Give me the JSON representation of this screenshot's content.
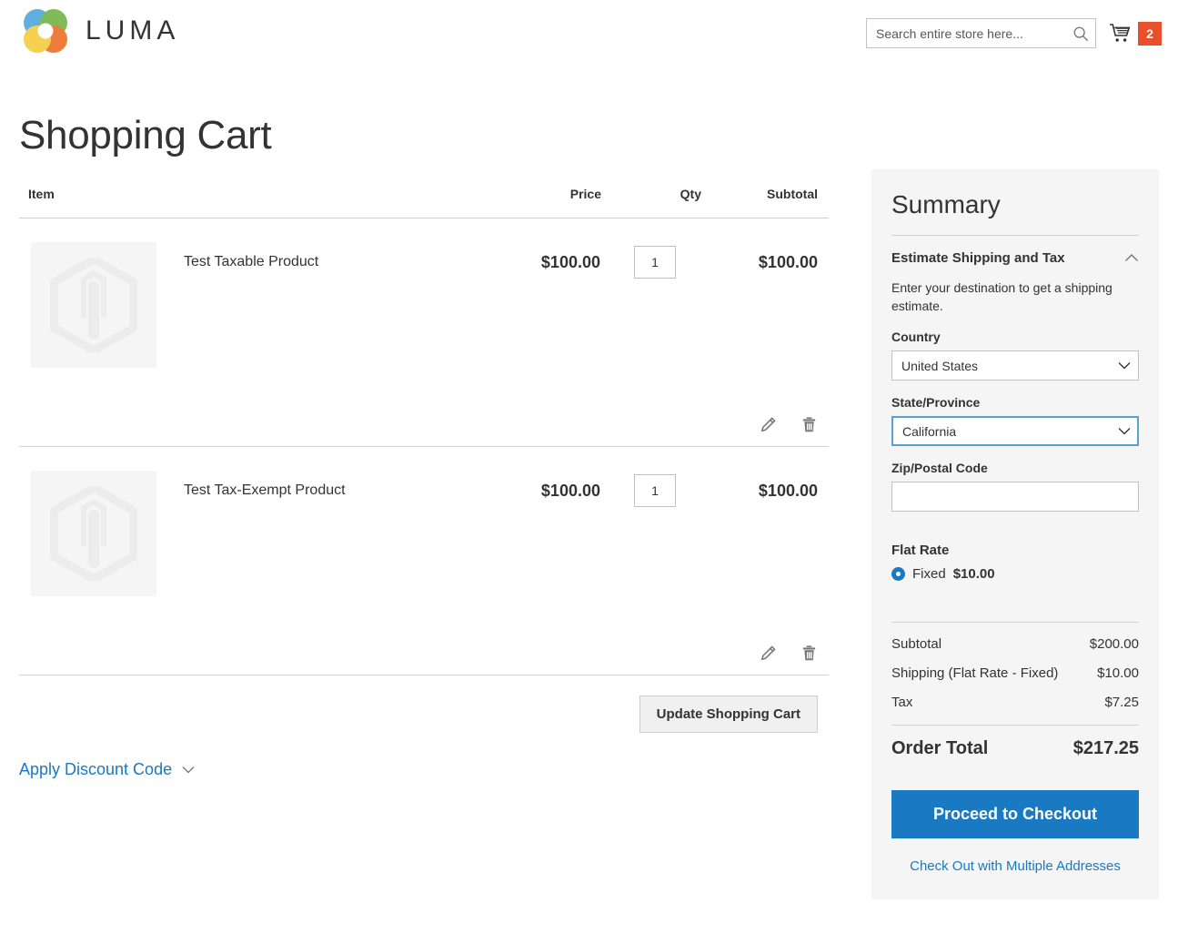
{
  "header": {
    "brand": "LUMA",
    "logo_icon": "luma-flower-logo",
    "logo_colors": [
      "#49a5dc",
      "#6fb243",
      "#ec6b23",
      "#f4cb38"
    ],
    "search": {
      "placeholder": "Search entire store here...",
      "value": "",
      "icon": "search-icon"
    },
    "cart": {
      "icon": "shopping-cart-icon",
      "count": "2",
      "badge_color": "#e8502c"
    }
  },
  "page": {
    "title": "Shopping Cart"
  },
  "cart_table": {
    "columns": [
      "Item",
      "Price",
      "Qty",
      "Subtotal"
    ],
    "rows": [
      {
        "name": "Test Taxable Product",
        "price": "$100.00",
        "qty": "1",
        "subtotal": "$100.00",
        "thumb_icon": "magento-placeholder-icon",
        "edit_icon": "pencil-icon",
        "delete_icon": "trash-icon"
      },
      {
        "name": "Test Tax-Exempt Product",
        "price": "$100.00",
        "qty": "1",
        "subtotal": "$100.00",
        "thumb_icon": "magento-placeholder-icon",
        "edit_icon": "pencil-icon",
        "delete_icon": "trash-icon"
      }
    ],
    "update_button": "Update Shopping Cart",
    "discount_toggle": "Apply Discount Code",
    "discount_chevron_icon": "chevron-down-icon"
  },
  "summary": {
    "heading": "Summary",
    "estimate": {
      "title": "Estimate Shipping and Tax",
      "chevron_icon": "chevron-up-icon",
      "description": "Enter your destination to get a shipping estimate.",
      "country_label": "Country",
      "country_value": "United States",
      "country_options": [
        "United States"
      ],
      "state_label": "State/Province",
      "state_value": "California",
      "state_options": [
        "California"
      ],
      "zip_label": "Zip/Postal Code",
      "zip_value": "",
      "zip_placeholder": ""
    },
    "shipping_method": {
      "carrier": "Flat Rate",
      "option_name": "Fixed",
      "option_price": "$10.00",
      "selected": true
    },
    "totals": [
      {
        "label": "Subtotal",
        "value": "$200.00"
      },
      {
        "label": "Shipping (Flat Rate - Fixed)",
        "value": "$10.00"
      },
      {
        "label": "Tax",
        "value": "$7.25"
      }
    ],
    "grand_total": {
      "label": "Order Total",
      "value": "$217.25"
    },
    "checkout_button": "Proceed to Checkout",
    "multi_address_link": "Check Out with Multiple Addresses",
    "accent_color": "#1979c3",
    "panel_bg": "#f5f5f5"
  }
}
